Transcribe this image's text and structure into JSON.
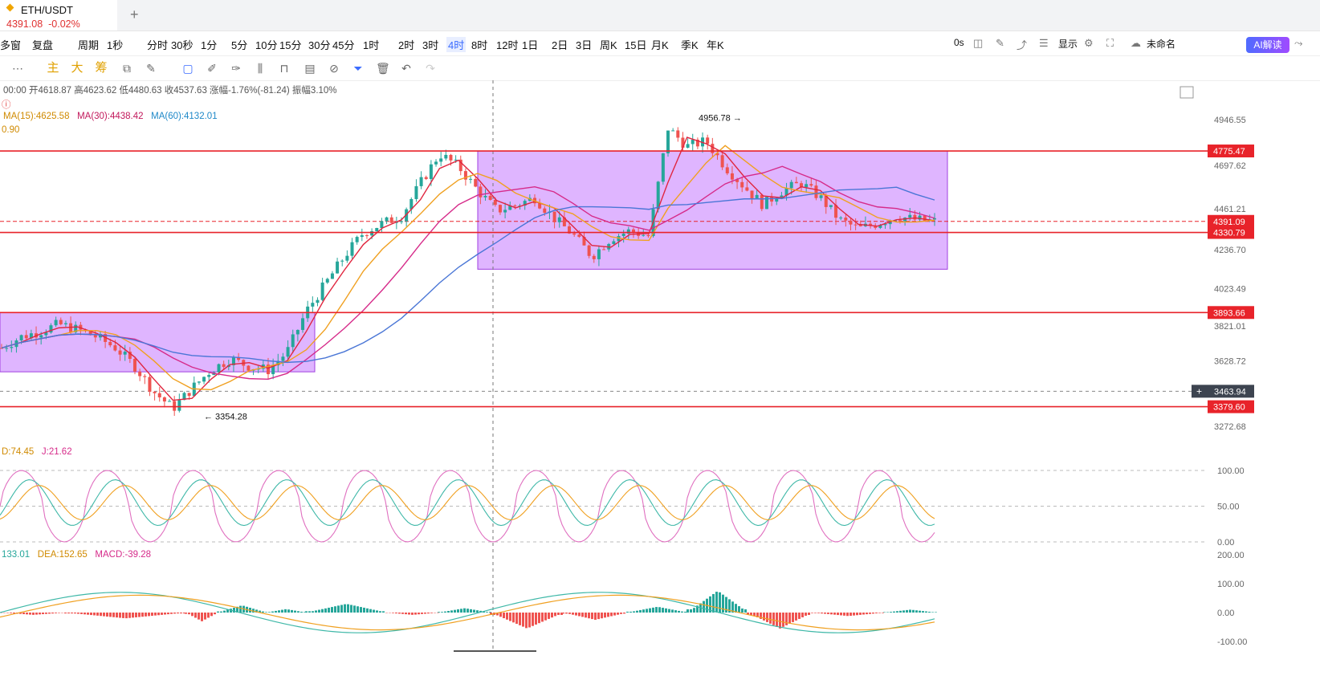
{
  "tab": {
    "symbol": "ETH/USDT",
    "price": "4391.08",
    "change": "-0.02%",
    "add": "+"
  },
  "toolbar1": {
    "items": [
      "多窗",
      "复盘",
      "周期",
      "1秒",
      "分时",
      "30秒",
      "1分",
      "5分",
      "10分",
      "15分",
      "30分",
      "45分",
      "1时",
      "2时",
      "3时",
      "4时",
      "8时",
      "12时",
      "1日",
      "2日",
      "3日",
      "周K",
      "15日",
      "月K",
      "季K",
      "年K"
    ],
    "active": "4时",
    "zero_s": "0s",
    "display": "显示",
    "unnamed": "未命名",
    "ai": "AI解读"
  },
  "toolbar2": {
    "labels": [
      "主",
      "大",
      "筹"
    ]
  },
  "header": {
    "ohlc": "00:00 开4618.87 高4623.62 低4480.63 收4537.63 涨幅-1.76%(-81.24) 振幅3.10%",
    "ma15": "MA(15):4625.58",
    "ma30": "MA(30):4438.42",
    "ma60": "MA(60):4132.01",
    "ma_extra": "0.90"
  },
  "price_axis": [
    "4946.55",
    "4697.62",
    "4461.21",
    "4236.70",
    "4023.49",
    "3821.01",
    "3628.72",
    "3272.68"
  ],
  "levels": [
    {
      "label": "4775.47",
      "value": 4775.47,
      "color": "#e8232a"
    },
    {
      "label": "4330.79",
      "value": 4330.79,
      "color": "#e8232a"
    },
    {
      "label": "3893.66",
      "value": 3893.66,
      "color": "#e8232a"
    },
    {
      "label": "3379.60",
      "value": 3379.6,
      "color": "#e8232a"
    }
  ],
  "current_price": {
    "label": "4391.09",
    "value": 4391.09,
    "color": "#e8232a"
  },
  "cursor_price": {
    "label": "3463.94",
    "value": 3463.94
  },
  "annotations": {
    "high": "4956.78 →",
    "low": "← 3354.28"
  },
  "kdj": {
    "label_d": "D:74.45",
    "label_j": "J:21.62",
    "axis": [
      "100.00",
      "50.00",
      "0.00"
    ]
  },
  "macd": {
    "dif": "133.01",
    "dea": "DEA:152.65",
    "macd": "MACD:-39.28",
    "axis": [
      "200.00",
      "100.00",
      "0.00",
      "-100.00"
    ]
  },
  "colors": {
    "up": "#26a69a",
    "down": "#ef5350",
    "ma_red": "#e0263f",
    "ma_orange": "#f0a020",
    "ma_blue": "#4a76d6",
    "ma_magenta": "#d62b8a",
    "box": "#d9a8ff",
    "accent": "#3b6cff"
  },
  "chart_data": {
    "type": "candlestick",
    "box_ranges": [
      {
        "from": "3354.28",
        "to": "3893.66"
      },
      {
        "from": "4130",
        "to": "4775.47"
      }
    ],
    "close_path": [
      3700,
      3760,
      3790,
      3830,
      3800,
      3760,
      3700,
      3600,
      3460,
      3370,
      3480,
      3580,
      3640,
      3600,
      3580,
      3680,
      3900,
      4050,
      4200,
      4330,
      4380,
      4420,
      4600,
      4760,
      4690,
      4560,
      4450,
      4480,
      4520,
      4410,
      4320,
      4200,
      4300,
      4340,
      4310,
      4900,
      4800,
      4830,
      4690,
      4580,
      4480,
      4560,
      4600,
      4520,
      4400,
      4350,
      4380,
      4420,
      4400,
      4391
    ]
  }
}
